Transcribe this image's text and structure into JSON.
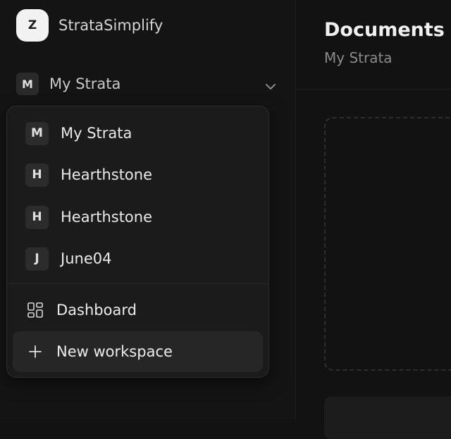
{
  "brand": {
    "avatar_letter": "Z",
    "name": "StrataSimplify"
  },
  "workspace_switcher": {
    "badge": "M",
    "name": "My Strata"
  },
  "dropdown": {
    "workspaces": [
      {
        "badge": "M",
        "label": "My Strata"
      },
      {
        "badge": "H",
        "label": "Hearthstone"
      },
      {
        "badge": "H",
        "label": "Hearthstone"
      },
      {
        "badge": "J",
        "label": "June04"
      }
    ],
    "actions": {
      "dashboard": {
        "label": "Dashboard",
        "icon": "dashboard-icon"
      },
      "new_workspace": {
        "label": "New workspace",
        "icon": "plus-icon"
      }
    }
  },
  "main": {
    "title": "Documents",
    "subtitle": "My Strata"
  }
}
